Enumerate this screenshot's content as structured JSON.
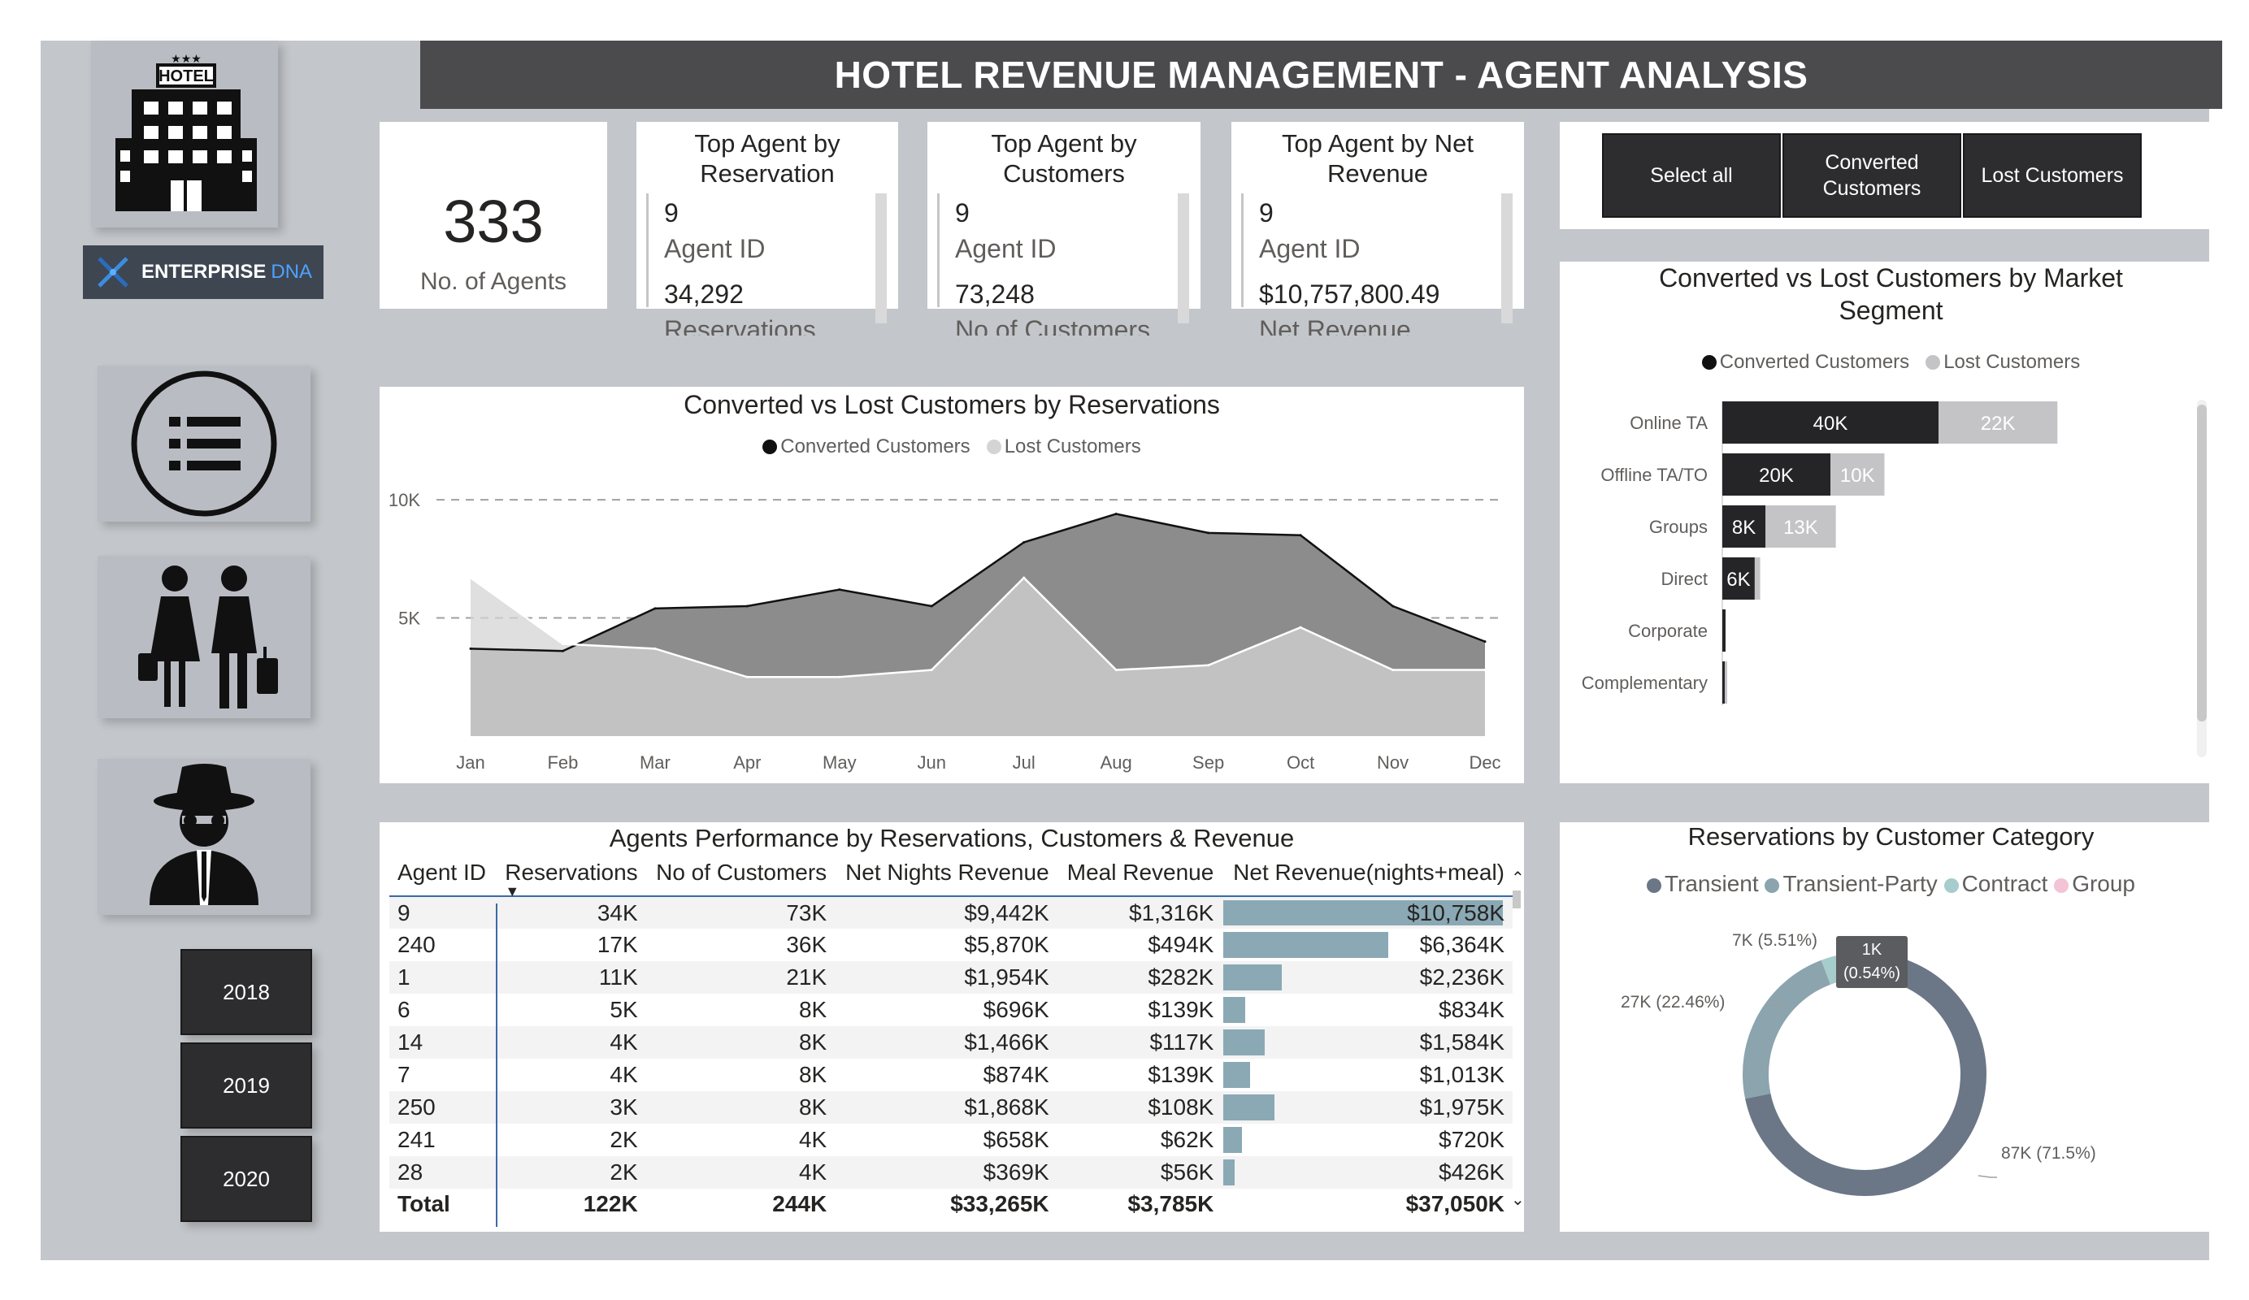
{
  "header": {
    "title": "HOTEL REVENUE MANAGEMENT - AGENT ANALYSIS"
  },
  "logo": {
    "hotel_sign": "HOTEL",
    "brand_a": "ENTERPRISE",
    "brand_b": "DNA"
  },
  "years": [
    "2018",
    "2019",
    "2020"
  ],
  "kpi": {
    "value": "333",
    "label": "No. of Agents"
  },
  "cards": [
    {
      "title": "Top Agent by Reservation",
      "id": "9",
      "id_label": "Agent ID",
      "value": "34,292",
      "value_label": "Reservations"
    },
    {
      "title": "Top Agent by Customers",
      "id": "9",
      "id_label": "Agent ID",
      "value": "73,248",
      "value_label": "No of Customers"
    },
    {
      "title": "Top Agent by Net Revenue",
      "id": "9",
      "id_label": "Agent ID",
      "value": "$10,757,800.49",
      "value_label": "Net Revenue"
    }
  ],
  "slicer": {
    "buttons": [
      "Select all",
      "Converted Customers",
      "Lost Customers"
    ]
  },
  "area_chart": {
    "title": "Converted vs Lost Customers by Reservations",
    "legend": [
      "Converted Customers",
      "Lost Customers"
    ],
    "colors": {
      "converted": "#8c8c8c",
      "lost": "#d4d4d4",
      "converted_line": "#111111",
      "lost_line": "#ffffff"
    }
  },
  "bar_chart": {
    "title": "Converted vs Lost Customers by Market Segment",
    "legend": [
      "Converted Customers",
      "Lost Customers"
    ]
  },
  "table": {
    "title": "Agents Performance by Reservations, Customers & Revenue",
    "columns": [
      "Agent ID",
      "Reservations",
      "No of Customers",
      "Net Nights Revenue",
      "Meal Revenue",
      "Net Revenue(nights+meal)"
    ],
    "rows": [
      [
        "9",
        "34K",
        "73K",
        "$9,442K",
        "$1,316K",
        "$10,758K"
      ],
      [
        "240",
        "17K",
        "36K",
        "$5,870K",
        "$494K",
        "$6,364K"
      ],
      [
        "1",
        "11K",
        "21K",
        "$1,954K",
        "$282K",
        "$2,236K"
      ],
      [
        "6",
        "5K",
        "8K",
        "$696K",
        "$139K",
        "$834K"
      ],
      [
        "14",
        "4K",
        "8K",
        "$1,466K",
        "$117K",
        "$1,584K"
      ],
      [
        "7",
        "4K",
        "8K",
        "$874K",
        "$139K",
        "$1,013K"
      ],
      [
        "250",
        "3K",
        "8K",
        "$1,868K",
        "$108K",
        "$1,975K"
      ],
      [
        "241",
        "2K",
        "4K",
        "$658K",
        "$62K",
        "$720K"
      ],
      [
        "28",
        "2K",
        "4K",
        "$369K",
        "$56K",
        "$426K"
      ]
    ],
    "net_revenue_k": [
      10758,
      6364,
      2236,
      834,
      1584,
      1013,
      1975,
      720,
      426
    ],
    "total": [
      "Total",
      "122K",
      "244K",
      "$33,265K",
      "$3,785K",
      "$37,050K"
    ]
  },
  "donut": {
    "title": "Reservations by Customer Category",
    "legend": [
      "Transient",
      "Transient-Party",
      "Contract",
      "Group"
    ],
    "labels": {
      "transient": "87K (71.5%)",
      "party": "27K (22.46%)",
      "contract": "7K (5.51%)",
      "group_a": "1K",
      "group_b": "(0.54%)"
    }
  },
  "chart_data": [
    {
      "type": "area",
      "title": "Converted vs Lost Customers by Reservations",
      "categories": [
        "Jan",
        "Feb",
        "Mar",
        "Apr",
        "May",
        "Jun",
        "Jul",
        "Aug",
        "Sep",
        "Oct",
        "Nov",
        "Dec"
      ],
      "series": [
        {
          "name": "Converted Customers",
          "values": [
            3700,
            3600,
            5400,
            5500,
            6200,
            5500,
            8200,
            9400,
            8600,
            8500,
            5500,
            4000
          ]
        },
        {
          "name": "Lost Customers",
          "values": [
            6700,
            3900,
            3700,
            2500,
            2500,
            2800,
            6700,
            2800,
            3000,
            4600,
            2800,
            2800
          ]
        }
      ],
      "y_ticks": [
        "5K",
        "10K"
      ],
      "ylim": [
        0,
        11000
      ],
      "grid": true,
      "legend_position": "top"
    },
    {
      "type": "bar",
      "orientation": "horizontal-stacked",
      "title": "Converted vs Lost Customers by Market Segment",
      "categories": [
        "Online TA",
        "Offline TA/TO",
        "Groups",
        "Direct",
        "Corporate",
        "Complementary"
      ],
      "series": [
        {
          "name": "Converted Customers",
          "values": [
            40,
            20,
            8,
            6,
            0.6,
            0.1
          ],
          "labels": [
            "40K",
            "20K",
            "8K",
            "6K",
            "",
            ""
          ]
        },
        {
          "name": "Lost Customers",
          "values": [
            22,
            10,
            13,
            1,
            0,
            0.1
          ],
          "labels": [
            "22K",
            "10K",
            "13K",
            "",
            "",
            ""
          ]
        }
      ],
      "unit": "K",
      "legend_position": "top",
      "colors": {
        "converted": "#252427",
        "lost": "#c4c4c6"
      }
    },
    {
      "type": "pie",
      "variant": "donut",
      "title": "Reservations by Customer Category",
      "categories": [
        "Transient",
        "Transient-Party",
        "Contract",
        "Group"
      ],
      "values": [
        71.5,
        22.46,
        5.51,
        0.54
      ],
      "colors": [
        "#6b7787",
        "#8ba4ae",
        "#a6cccc",
        "#f4c3d6"
      ],
      "legend_position": "top"
    }
  ]
}
